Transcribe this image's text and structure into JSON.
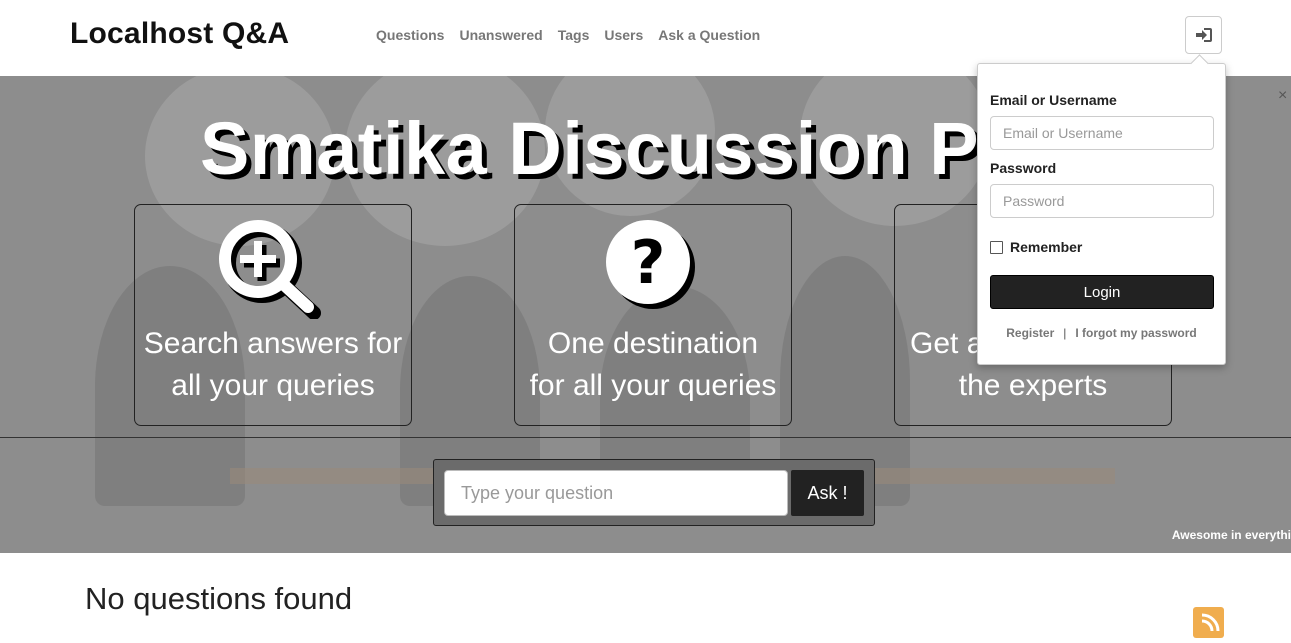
{
  "header": {
    "logo": "Localhost Q&A",
    "nav": [
      "Questions",
      "Unanswered",
      "Tags",
      "Users",
      "Ask a Question"
    ],
    "login_icon": "sign-in-icon"
  },
  "hero": {
    "title": "Smatika Discussion Po",
    "close_icon": "close-icon",
    "features": [
      {
        "icon": "search-plus-icon",
        "line1": "Search answers for",
        "line2": "all your queries"
      },
      {
        "icon": "question-circle-icon",
        "line1": "One destination",
        "line2": "for all your queries"
      },
      {
        "icon": "user-icon",
        "line1": "Get a",
        "line2": "the experts"
      }
    ],
    "ask_placeholder": "Type your question",
    "ask_button": "Ask !",
    "tagline": "Awesome in everythi"
  },
  "login": {
    "email_label": "Email or Username",
    "email_placeholder": "Email or Username",
    "password_label": "Password",
    "password_placeholder": "Password",
    "remember_label": "Remember",
    "login_button": "Login",
    "register_link": "Register",
    "separator": "|",
    "forgot_link": "I forgot my password"
  },
  "main": {
    "no_questions": "No questions found",
    "rss_icon": "rss-icon"
  },
  "colors": {
    "hero_overlay": "#8d8d8d",
    "button_dark": "#222222",
    "rss": "#f0ad4e"
  }
}
